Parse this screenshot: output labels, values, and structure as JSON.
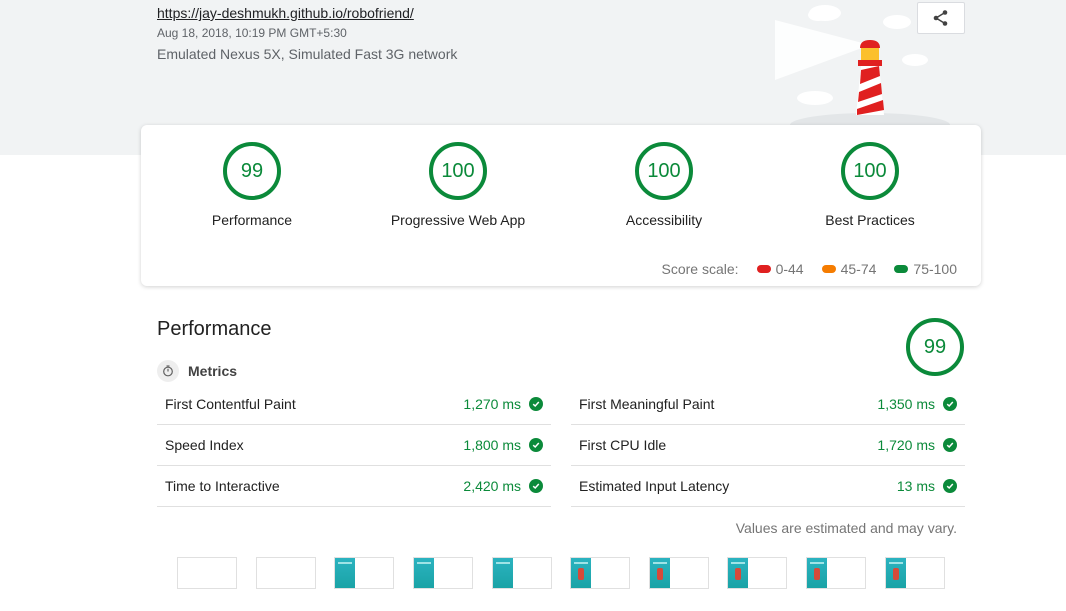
{
  "header": {
    "url": "https://jay-deshmukh.github.io/robofriend/",
    "datetime": "Aug 18, 2018, 10:19 PM GMT+5:30",
    "environment": "Emulated Nexus 5X, Simulated Fast 3G network"
  },
  "share": {
    "icon": "share-icon"
  },
  "scores": [
    {
      "value": "99",
      "label": "Performance"
    },
    {
      "value": "100",
      "label": "Progressive Web App"
    },
    {
      "value": "100",
      "label": "Accessibility"
    },
    {
      "value": "100",
      "label": "Best Practices"
    }
  ],
  "score_scale": {
    "label": "Score scale:",
    "ranges": [
      {
        "range": "0-44",
        "color": "#e02020"
      },
      {
        "range": "45-74",
        "color": "#f57c00"
      },
      {
        "range": "75-100",
        "color": "#0b8a3a"
      }
    ]
  },
  "performance": {
    "title": "Performance",
    "score": "99",
    "metrics_label": "Metrics",
    "metrics_left": [
      {
        "name": "First Contentful Paint",
        "value": "1,270 ms"
      },
      {
        "name": "Speed Index",
        "value": "1,800 ms"
      },
      {
        "name": "Time to Interactive",
        "value": "2,420 ms"
      }
    ],
    "metrics_right": [
      {
        "name": "First Meaningful Paint",
        "value": "1,350 ms"
      },
      {
        "name": "First CPU Idle",
        "value": "1,720 ms"
      },
      {
        "name": "Estimated Input Latency",
        "value": "13 ms"
      }
    ],
    "note": "Values are estimated and may vary."
  },
  "colors": {
    "pass": "#0b8a3a",
    "band": "#f1f3f4"
  }
}
